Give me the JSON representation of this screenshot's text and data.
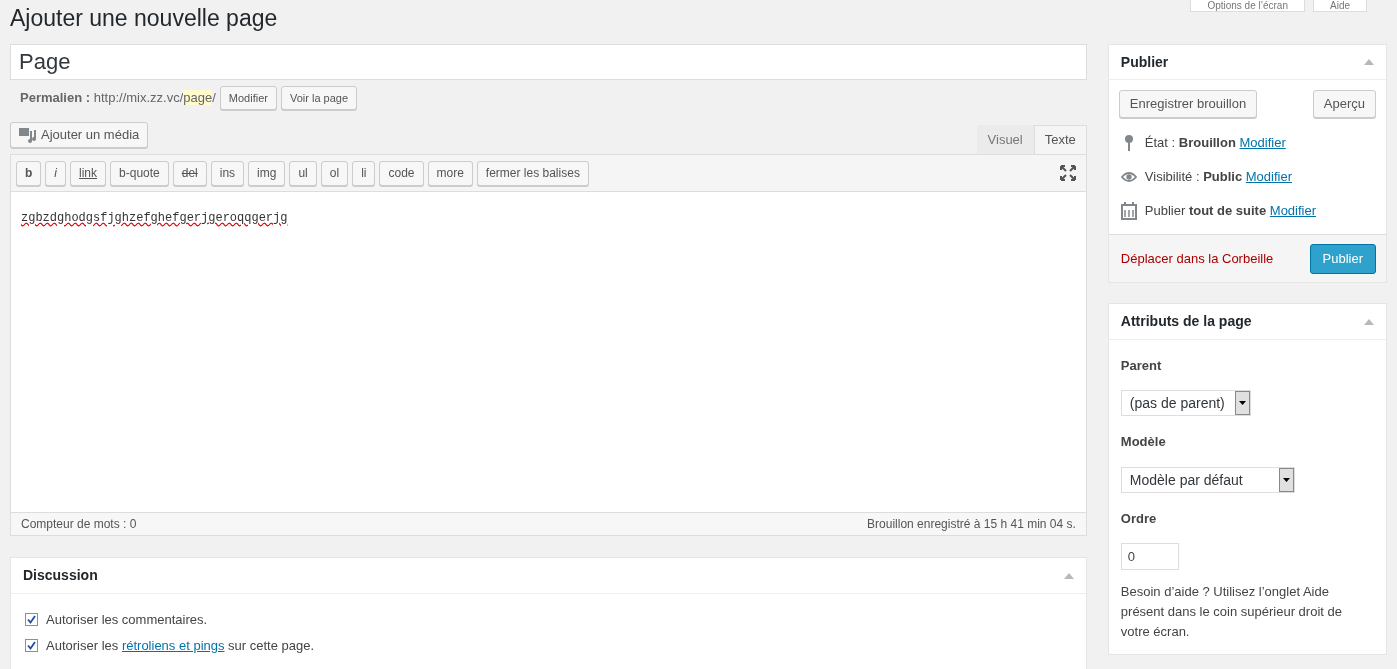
{
  "screen_buttons": [
    "Options de l’écran",
    "Aide"
  ],
  "heading": "Ajouter une nouvelle page",
  "title_field": {
    "value": "Page"
  },
  "permalink": {
    "label": "Permalien :",
    "base": "http://mix.zz.vc/",
    "slug": "page",
    "trail": "/",
    "buttons": [
      "Modifier",
      "Voir la page"
    ]
  },
  "media_button": "Ajouter un média",
  "editor_tabs": [
    {
      "label": "Visuel",
      "selected": false
    },
    {
      "label": "Texte",
      "selected": true
    }
  ],
  "quicktags": [
    {
      "label": "b",
      "kind": "bold"
    },
    {
      "label": "i",
      "kind": "italic"
    },
    {
      "label": "link",
      "kind": "underline"
    },
    {
      "label": "b-quote",
      "kind": "plain"
    },
    {
      "label": "del",
      "kind": "strike"
    },
    {
      "label": "ins",
      "kind": "plain"
    },
    {
      "label": "img",
      "kind": "plain"
    },
    {
      "label": "ul",
      "kind": "plain"
    },
    {
      "label": "ol",
      "kind": "plain"
    },
    {
      "label": "li",
      "kind": "plain"
    },
    {
      "label": "code",
      "kind": "plain"
    },
    {
      "label": "more",
      "kind": "plain"
    },
    {
      "label": "fermer les balises",
      "kind": "plain"
    }
  ],
  "content": "zgbzdghodgsfjghzefghefgerjgeroqqgerjg",
  "status_bar": {
    "word_count": "Compteur de mots : 0",
    "saved": "Brouillon enregistré à 15 h 41 min 04 s."
  },
  "discussion": {
    "title": "Discussion",
    "options": [
      {
        "prefix": "Autoriser les commentaires.",
        "checked": true
      },
      {
        "prefix": "Autoriser les ",
        "link": "rétroliens et pings",
        "suffix": " sur cette page.",
        "checked": true
      }
    ]
  },
  "publish": {
    "title": "Publier",
    "save_draft": "Enregistrer brouillon",
    "preview": "Aperçu",
    "rows": [
      {
        "kind": "status",
        "label": "État : ",
        "value": "Brouillon",
        "link": "Modifier"
      },
      {
        "kind": "visibility",
        "label": "Visibilité : ",
        "value": "Public",
        "link": "Modifier"
      },
      {
        "kind": "schedule",
        "label": "Publier ",
        "value": "tout de suite",
        "link": "Modifier"
      }
    ],
    "trash": "Déplacer dans la Corbeille",
    "publish_button": "Publier"
  },
  "attributes": {
    "title": "Attributs de la page",
    "parent_label": "Parent",
    "parent_value": "(pas de parent)",
    "template_label": "Modèle",
    "template_value": "Modèle par défaut",
    "order_label": "Ordre",
    "order_value": "0",
    "help": "Besoin d’aide ? Utilisez l’onglet Aide présent dans le coin supérieur droit de votre écran."
  }
}
